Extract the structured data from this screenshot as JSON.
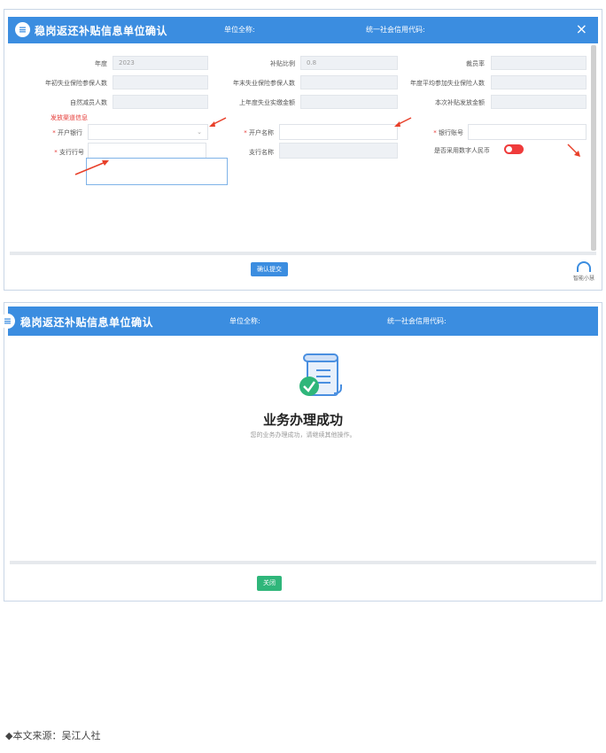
{
  "dialog1": {
    "title": "稳岗返还补贴信息单位确认",
    "unit_name_label": "单位全称:",
    "credit_code_label": "统一社会信用代码:",
    "close_glyph": "×",
    "fields": {
      "year_label": "年度",
      "year_value": "2023",
      "subsidy_ratio_label": "补贴比例",
      "subsidy_ratio_value": "0.8",
      "layoff_rate_label": "裁员率",
      "begin_insured_label": "年初失业保险参保人数",
      "end_insured_label": "年末失业保险参保人数",
      "avg_insured_label": "年度平均参加失业保险人数",
      "natural_reduction_label": "自然减员人数",
      "last_year_paid_label": "上年度失业实缴金额",
      "subsidy_amount_label": "本次补贴发放金额"
    },
    "payment_section_label": "发放渠道信息",
    "bank_label": "开户银行",
    "account_name_label": "开户名称",
    "account_number_label": "银行账号",
    "branch_code_label": "支行行号",
    "branch_name_label": "支行名称",
    "digital_rmb_label": "是否采用数字人民币",
    "required_mark": "*",
    "submit_button": "确认提交",
    "assistant_label": "智能小慧"
  },
  "dialog2": {
    "title": "稳岗返还补贴信息单位确认",
    "unit_name_label": "单位全称:",
    "credit_code_label": "统一社会信用代码:",
    "success_title": "业务办理成功",
    "success_message": "您的业务办理成功，请继续其他操作。",
    "close_button": "关闭"
  },
  "footer": {
    "source": "◆本文来源：吴江人社"
  },
  "colors": {
    "header_blue": "#3b8de0",
    "success_green": "#2fb67a",
    "required_red": "#e53935",
    "arrow_red": "#e8402a"
  },
  "toggle": {
    "digital_rmb_on": false
  }
}
